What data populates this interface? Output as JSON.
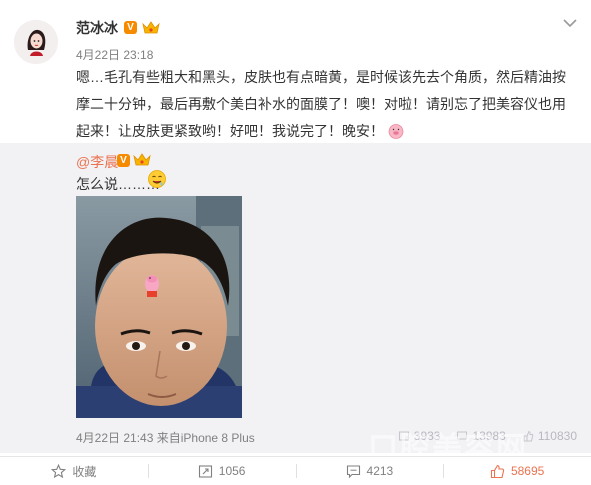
{
  "post": {
    "author": "范冰冰",
    "vip_badge": "V",
    "time": "4月22日 23:18",
    "text": "嗯…毛孔有些粗大和黑头，皮肤也有点暗黄，是时候该先去个角质，然后精油按摩二十分钟，最后再敷个美白补水的面膜了！噢！对啦！请别忘了把美容仪也用起来！让皮肤更紧致哟！好吧！我说完了！晚安！",
    "end_emoji": "pig-emoji"
  },
  "repost": {
    "author": "@李晨",
    "vip_badge": "V",
    "text": "怎么说………",
    "emoji": "drooling-face-emoji",
    "photo_alt": "selfie-photo",
    "meta": "4月22日 21:43 来自iPhone 8 Plus",
    "stats": [
      "3933",
      "13983",
      "110830"
    ]
  },
  "actions": {
    "favorite": "收藏",
    "repost": "1056",
    "comment": "4213",
    "like": "58695"
  },
  "watermark": "口腔美容网",
  "colors": {
    "accent": "#eb7350",
    "vip": "#f78b00",
    "repost_bg": "#f2f2f5",
    "meta_gray": "#808080"
  },
  "icons": [
    "more-chevron-icon",
    "star-icon",
    "repost-icon",
    "comment-icon",
    "like-icon"
  ]
}
